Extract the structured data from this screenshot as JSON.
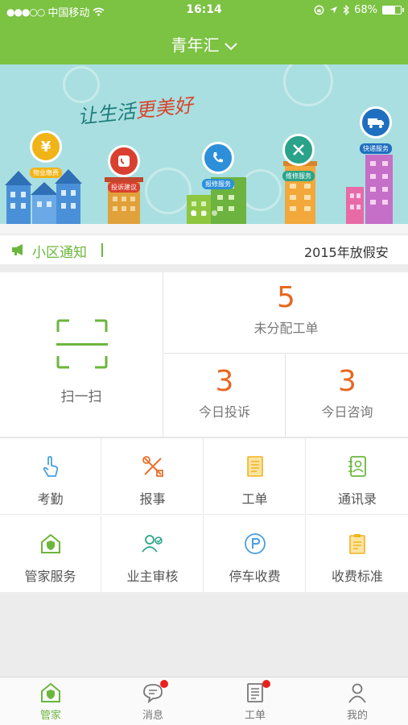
{
  "status_bar": {
    "carrier": "中国移动",
    "time": "16:14",
    "battery": "68%",
    "battery_level": 0.68
  },
  "header": {
    "title": "青年汇"
  },
  "banner": {
    "slogan_a": "让生活",
    "slogan_b": "更美好",
    "services": [
      {
        "label": "物业缴费",
        "icon": "yen-icon",
        "color": "#f1b416"
      },
      {
        "label": "投诉建议",
        "icon": "complaint-icon",
        "color": "#d94030"
      },
      {
        "label": "报修服务",
        "icon": "phone-icon",
        "color": "#2d8fd9"
      },
      {
        "label": "维修服务",
        "icon": "tools-icon",
        "color": "#2aa38a"
      },
      {
        "label": "快递服务",
        "icon": "truck-icon",
        "color": "#1f6fc0"
      }
    ]
  },
  "notice": {
    "label": "小区通知",
    "text": "2015年放假安"
  },
  "stats": {
    "scan_label": "扫一扫",
    "unassigned": {
      "value": "5",
      "label": "未分配工单"
    },
    "complaints": {
      "value": "3",
      "label": "今日投诉"
    },
    "consults": {
      "value": "3",
      "label": "今日咨询"
    }
  },
  "grid": [
    {
      "label": "考勤",
      "icon": "tap-hand-icon",
      "color": "#4a9ee0"
    },
    {
      "label": "报事",
      "icon": "tools-icon",
      "color": "#e8712d"
    },
    {
      "label": "工单",
      "icon": "document-icon",
      "color": "#efb520"
    },
    {
      "label": "通讯录",
      "icon": "contacts-icon",
      "color": "#6bb63c"
    },
    {
      "label": "管家服务",
      "icon": "house-shield-icon",
      "color": "#6bb63c"
    },
    {
      "label": "业主审核",
      "icon": "user-check-icon",
      "color": "#2aa38a"
    },
    {
      "label": "停车收费",
      "icon": "parking-icon",
      "color": "#4a9ee0"
    },
    {
      "label": "收费标准",
      "icon": "clipboard-icon",
      "color": "#efb520"
    }
  ],
  "tabs": [
    {
      "label": "管家",
      "icon": "house-shield-icon",
      "active": true,
      "badge": false
    },
    {
      "label": "消息",
      "icon": "chat-icon",
      "active": false,
      "badge": true
    },
    {
      "label": "工单",
      "icon": "document-icon",
      "active": false,
      "badge": true
    },
    {
      "label": "我的",
      "icon": "person-icon",
      "active": false,
      "badge": false
    }
  ],
  "colors": {
    "brand_green": "#7cc243",
    "accent_orange": "#e8671f",
    "badge_red": "#e8211d"
  }
}
